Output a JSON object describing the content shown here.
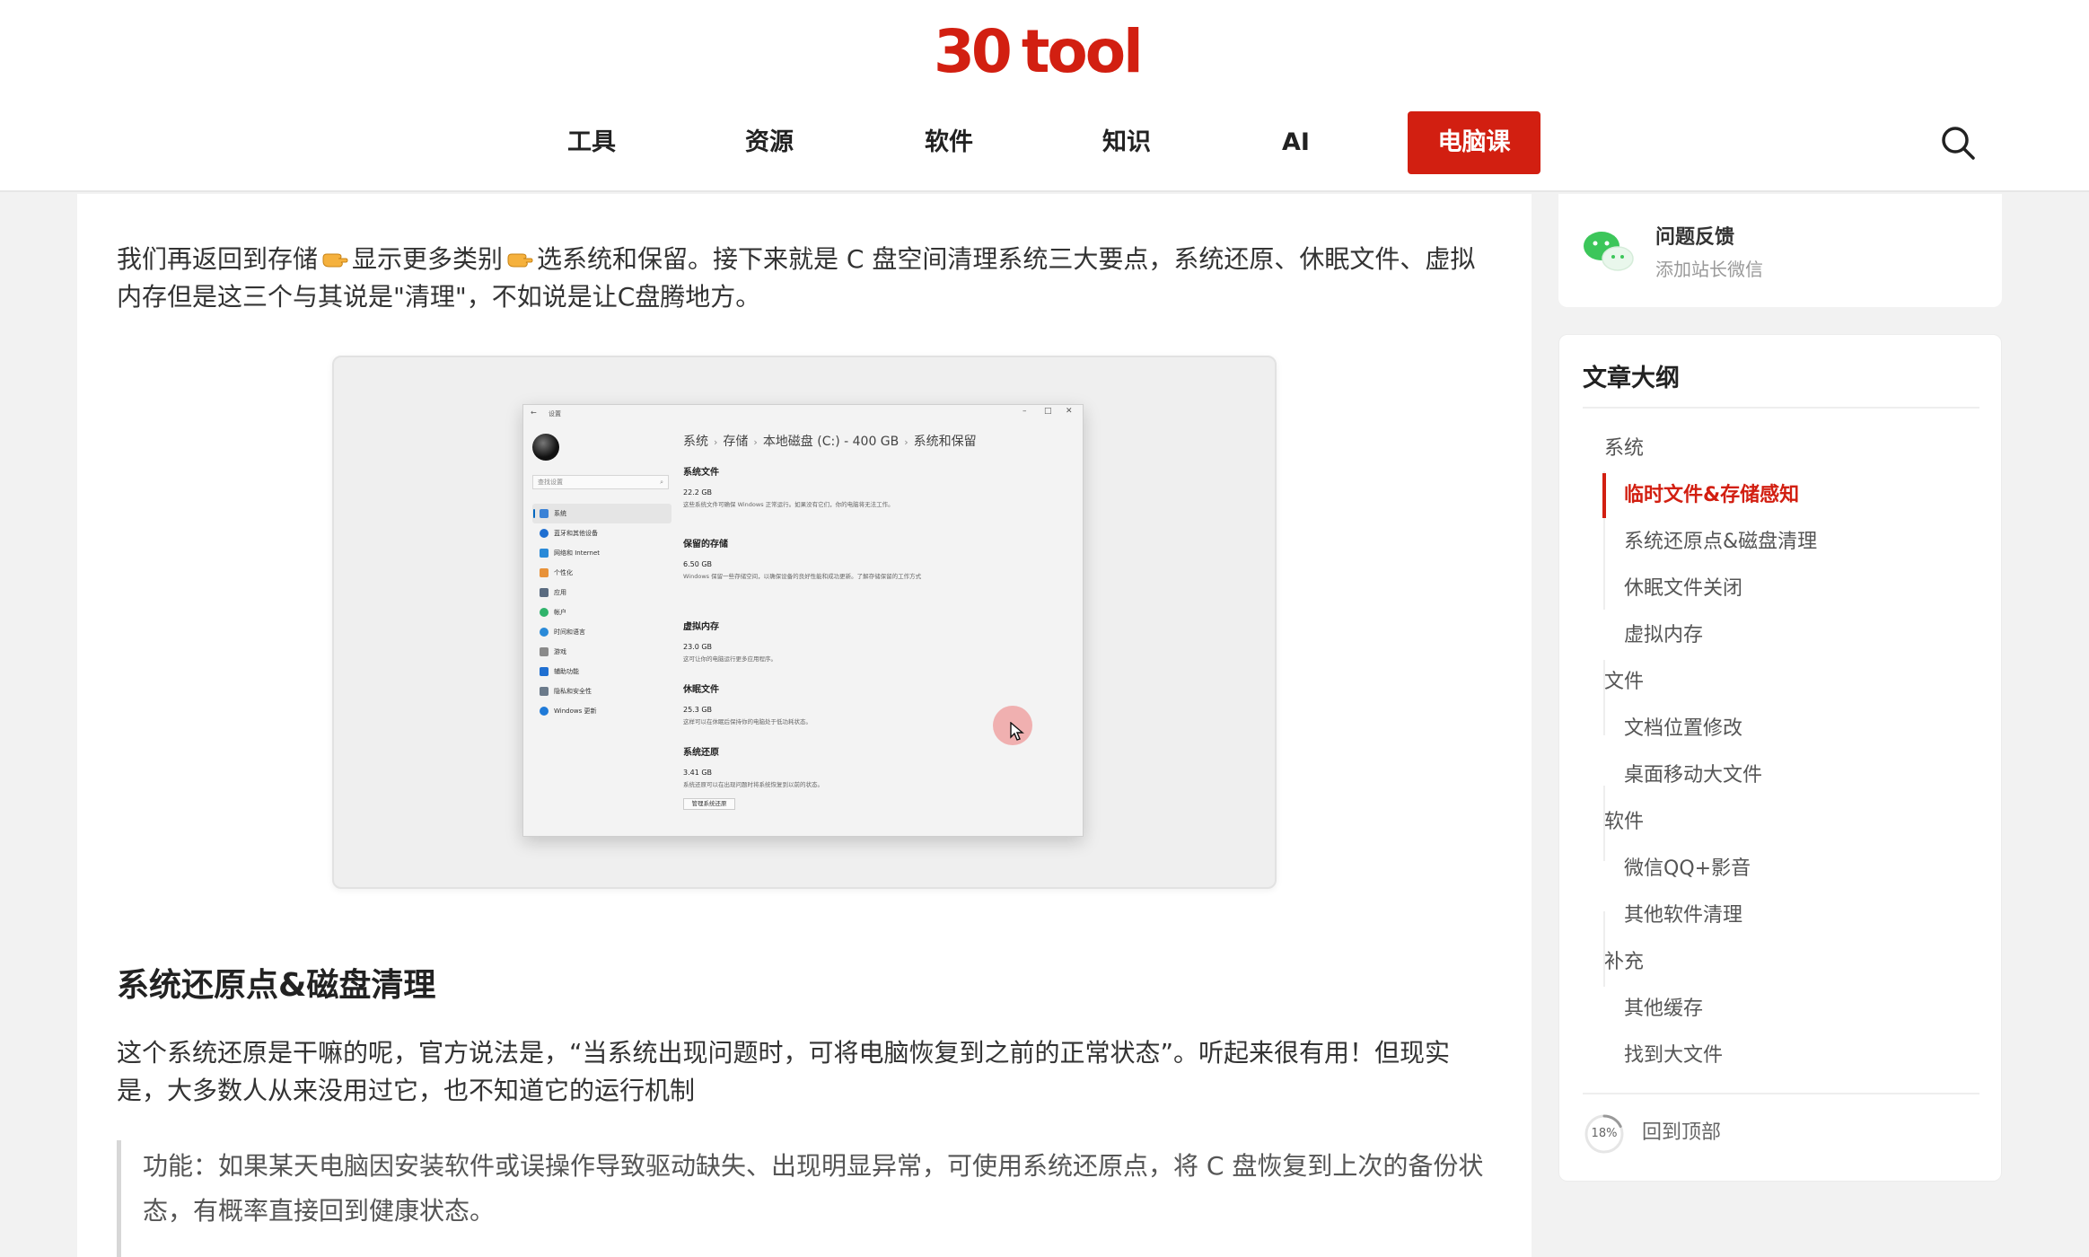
{
  "header": {
    "logo_num": "30",
    "logo_word": "tool",
    "nav": [
      {
        "label": "工具"
      },
      {
        "label": "资源"
      },
      {
        "label": "软件"
      },
      {
        "label": "知识"
      },
      {
        "label": "AI"
      },
      {
        "label": "电脑课",
        "active": true
      }
    ],
    "accent_color": "#d21f11"
  },
  "article": {
    "p1_a": "我们再返回到存储",
    "p1_b": "显示更多类别",
    "p1_c": "选系统和保留。接下来就是 C 盘空间清理系统三大要点，系统还原、休眠文件、虚拟内存但是这三个与其说是\"清理\"，不如说是让C盘腾地方。",
    "screenshot": {
      "window_title": "设置",
      "search_placeholder": "查找设置",
      "menu": [
        "系统",
        "蓝牙和其他设备",
        "网络和 Internet",
        "个性化",
        "应用",
        "帐户",
        "时间和语言",
        "游戏",
        "辅助功能",
        "隐私和安全性",
        "Windows 更新"
      ],
      "breadcrumb": [
        "系统",
        "存储",
        "本地磁盘 (C:) - 400 GB",
        "系统和保留"
      ],
      "sections": [
        {
          "title": "系统文件",
          "value": "22.2 GB",
          "desc": "这些系统文件可确保 Windows 正常运行。如果没有它们，你的电脑将无法工作。"
        },
        {
          "title": "保留的存储",
          "value": "6.50 GB",
          "desc": "Windows 保留一些存储空间，以确保设备的良好性能和成功更新。了解存储保留的工作方式"
        },
        {
          "title": "虚拟内存",
          "value": "23.0 GB",
          "desc": "这可让你的电脑运行更多应用程序。"
        },
        {
          "title": "休眠文件",
          "value": "25.3 GB",
          "desc": "这样可以在休眠后保持你的电脑处于低功耗状态。"
        },
        {
          "title": "系统还原",
          "value": "3.41 GB",
          "desc": "系统还原可以在出现问题时将系统恢复到以前的状态。"
        }
      ],
      "manage_button": "管理系统还原"
    },
    "h2": "系统还原点&磁盘清理",
    "p2": "这个系统还原是干嘛的呢，官方说法是，“当系统出现问题时，可将电脑恢复到之前的正常状态”。听起来很有用！但现实是，大多数人从来没用过它，也不知道它的运行机制",
    "quote": "功能：如果某天电脑因安装软件或误操作导致驱动缺失、出现明显异常，可使用系统还原点，将 C 盘恢复到上次的备份状态，有概率直接回到健康状态。"
  },
  "sidebar": {
    "feedback_title": "问题反馈",
    "feedback_sub": "添加站长微信",
    "toc_title": "文章大纲",
    "toc": [
      {
        "label": "系统",
        "level": 1
      },
      {
        "label": "临时文件&存储感知",
        "level": 2,
        "active": true
      },
      {
        "label": "系统还原点&磁盘清理",
        "level": 2
      },
      {
        "label": "休眠文件关闭",
        "level": 2
      },
      {
        "label": "虚拟内存",
        "level": 2
      },
      {
        "label": "文件",
        "level": 1
      },
      {
        "label": "文档位置修改",
        "level": 2
      },
      {
        "label": "桌面移动大文件",
        "level": 2
      },
      {
        "label": "软件",
        "level": 1
      },
      {
        "label": "微信QQ+影音",
        "level": 2
      },
      {
        "label": "其他软件清理",
        "level": 2
      },
      {
        "label": "补充",
        "level": 1
      },
      {
        "label": "其他缓存",
        "level": 2
      },
      {
        "label": "找到大文件",
        "level": 2
      }
    ],
    "progress_label": "18%",
    "progress": 0.18,
    "back_to_top": "回到顶部"
  }
}
